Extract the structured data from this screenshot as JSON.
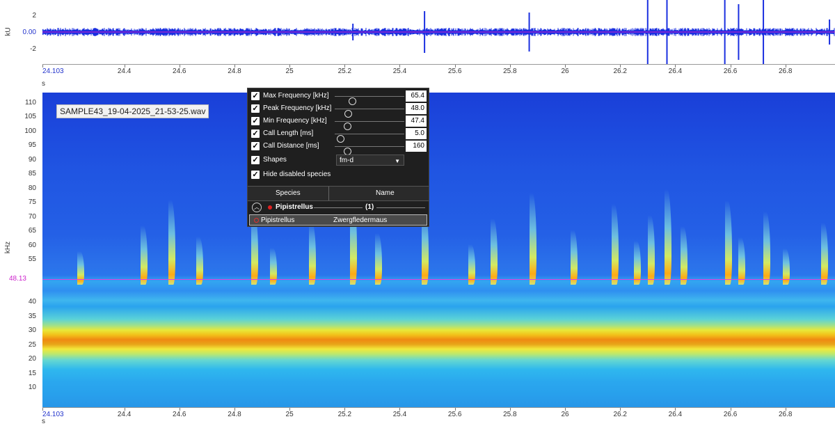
{
  "waveform": {
    "y_unit": "kU",
    "y_ticks": [
      "2",
      "0.00",
      "-2"
    ],
    "x_unit": "s",
    "x_ticks": [
      "24.103",
      "24.4",
      "24.6",
      "24.8",
      "25",
      "25.2",
      "25.4",
      "25.6",
      "25.8",
      "26",
      "26.2",
      "26.4",
      "26.6",
      "26.8"
    ]
  },
  "spectrogram": {
    "file_name": "SAMPLE43_19-04-2025_21-53-25.wav",
    "y_unit": "kHz",
    "y_ticks": [
      "110",
      "105",
      "100",
      "95",
      "90",
      "85",
      "80",
      "75",
      "70",
      "65",
      "60",
      "55",
      "40",
      "35",
      "30",
      "25",
      "20",
      "15",
      "10"
    ],
    "marker_label": "48.13",
    "x_unit": "s",
    "x_ticks": [
      "24.103",
      "24.4",
      "24.6",
      "24.8",
      "25",
      "25.2",
      "25.4",
      "25.6",
      "25.8",
      "26",
      "26.2",
      "26.4",
      "26.6",
      "26.8"
    ],
    "colors": {
      "low": "#1a3fd8",
      "mid": "#2fb8ee",
      "high": "#f2c21a",
      "peak": "#f08a12",
      "marker": "#e040e0"
    }
  },
  "filter_panel": {
    "filters": [
      {
        "label": "Max Frequency [kHz]",
        "value": "65.4",
        "checked": true,
        "level": 0.27
      },
      {
        "label": "Peak Frequency [kHz]",
        "value": "48.0",
        "checked": true,
        "level": 0.22
      },
      {
        "label": "Min Frequency [kHz]",
        "value": "47.4",
        "checked": true,
        "level": 0.21
      },
      {
        "label": "Call Length [ms]",
        "value": "5.0",
        "checked": true,
        "level": 0.11
      },
      {
        "label": "Call Distance [ms]",
        "value": "160",
        "checked": true,
        "level": 0.21
      }
    ],
    "shapes": {
      "label": "Shapes",
      "value": "fm-d",
      "checked": true
    },
    "hide_disabled": {
      "label": "Hide disabled species",
      "checked": true
    },
    "table": {
      "col_species": "Species",
      "col_name": "Name",
      "group": {
        "name": "Pipistrellus",
        "count": "(1)"
      },
      "rows": [
        {
          "species": "Pipistrellus",
          "name": "Zwergfledermaus"
        }
      ]
    }
  }
}
